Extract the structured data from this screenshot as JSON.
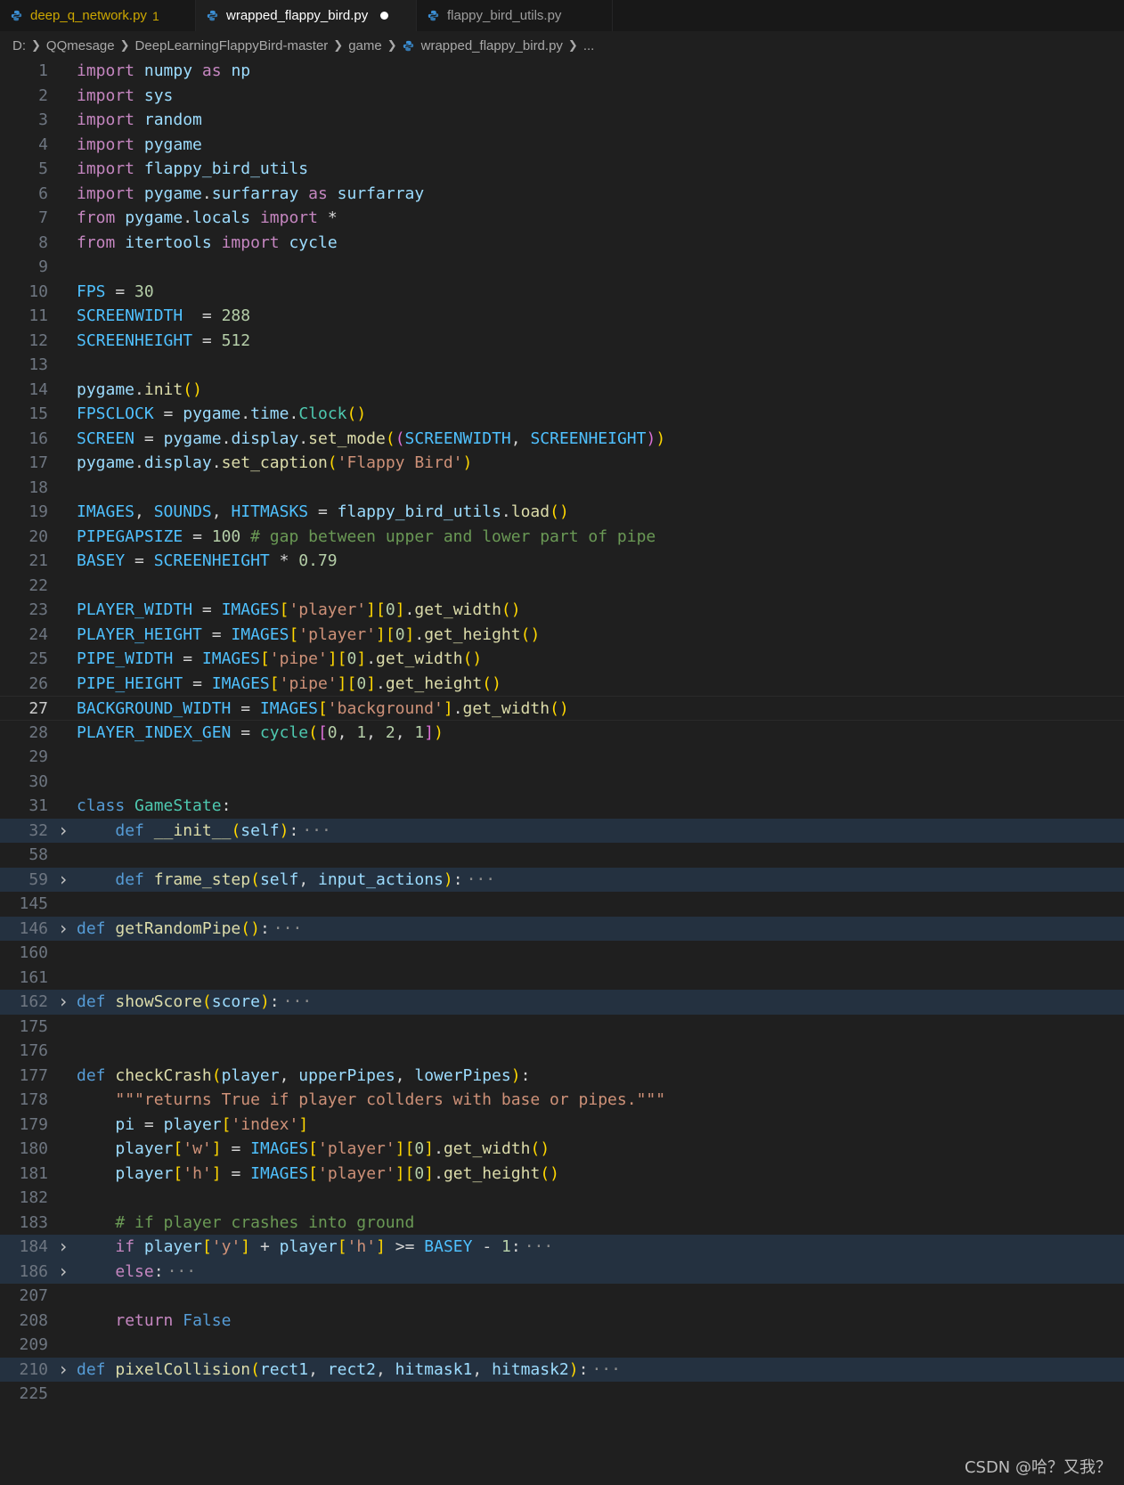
{
  "tabs": [
    {
      "label": "deep_q_network.py",
      "badge": "1",
      "state": "modified-error"
    },
    {
      "label": "wrapped_flappy_bird.py",
      "state": "active-unsaved"
    },
    {
      "label": "flappy_bird_utils.py",
      "state": "inactive"
    }
  ],
  "breadcrumb": [
    "D:",
    "QQmesage",
    "DeepLearningFlappyBird-master",
    "game",
    "wrapped_flappy_bird.py",
    "..."
  ],
  "line_numbers": [
    "1",
    "2",
    "3",
    "4",
    "5",
    "6",
    "7",
    "8",
    "9",
    "10",
    "11",
    "12",
    "13",
    "14",
    "15",
    "16",
    "17",
    "18",
    "19",
    "20",
    "21",
    "22",
    "23",
    "24",
    "25",
    "26",
    "27",
    "28",
    "29",
    "30",
    "31",
    "32",
    "58",
    "59",
    "145",
    "146",
    "160",
    "161",
    "162",
    "175",
    "176",
    "177",
    "178",
    "179",
    "180",
    "181",
    "182",
    "183",
    "184",
    "186",
    "207",
    "208",
    "209",
    "210",
    "225"
  ],
  "current_line": "27",
  "folded_lines": [
    "32",
    "59",
    "146",
    "162",
    "184",
    "186",
    "210"
  ],
  "code_lines": [
    "import numpy as np",
    "import sys",
    "import random",
    "import pygame",
    "import flappy_bird_utils",
    "import pygame.surfarray as surfarray",
    "from pygame.locals import *",
    "from itertools import cycle",
    "",
    "FPS = 30",
    "SCREENWIDTH  = 288",
    "SCREENHEIGHT = 512",
    "",
    "pygame.init()",
    "FPSCLOCK = pygame.time.Clock()",
    "SCREEN = pygame.display.set_mode((SCREENWIDTH, SCREENHEIGHT))",
    "pygame.display.set_caption('Flappy Bird')",
    "",
    "IMAGES, SOUNDS, HITMASKS = flappy_bird_utils.load()",
    "PIPEGAPSIZE = 100 # gap between upper and lower part of pipe",
    "BASEY = SCREENHEIGHT * 0.79",
    "",
    "PLAYER_WIDTH = IMAGES['player'][0].get_width()",
    "PLAYER_HEIGHT = IMAGES['player'][0].get_height()",
    "PIPE_WIDTH = IMAGES['pipe'][0].get_width()",
    "PIPE_HEIGHT = IMAGES['pipe'][0].get_height()",
    "BACKGROUND_WIDTH = IMAGES['background'].get_width()",
    "PLAYER_INDEX_GEN = cycle([0, 1, 2, 1])",
    "",
    "",
    "class GameState:",
    "    def __init__(self):",
    "",
    "    def frame_step(self, input_actions):",
    "",
    "def getRandomPipe():",
    "",
    "",
    "def showScore(score):",
    "",
    "",
    "def checkCrash(player, upperPipes, lowerPipes):",
    "    \"\"\"returns True if player collders with base or pipes.\"\"\"",
    "    pi = player['index']",
    "    player['w'] = IMAGES['player'][0].get_width()",
    "    player['h'] = IMAGES['player'][0].get_height()",
    "",
    "    # if player crashes into ground",
    "    if player['y'] + player['h'] >= BASEY - 1:",
    "    else:",
    "",
    "    return False",
    "",
    "def pixelCollision(rect1, rect2, hitmask1, hitmask2):",
    ""
  ],
  "fold_ellipsis": "···",
  "watermark": "CSDN @哈？又我？",
  "colors": {
    "background": "#1f1f1f",
    "tabbar": "#181818",
    "folded_highlight": "#243140",
    "keyword": "#c586c0",
    "keyword_blue": "#569cd6",
    "class": "#4ec9b0",
    "function": "#dcdcaa",
    "variable": "#9cdcfe",
    "constant": "#4fc1ff",
    "number": "#b5cea8",
    "string": "#ce9178",
    "comment": "#6a9955"
  }
}
